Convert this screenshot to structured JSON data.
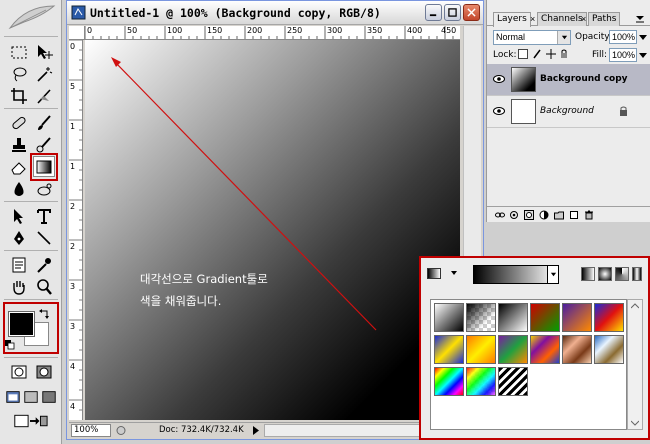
{
  "document": {
    "title": "Untitled-1 @ 100% (Background copy, RGB/8)",
    "ruler_h_ticks": [
      "0",
      "50",
      "100",
      "150",
      "200",
      "250",
      "300",
      "350",
      "400",
      "450"
    ],
    "ruler_v_ticks": [
      "0",
      "5",
      "1",
      "1",
      "2",
      "2",
      "3",
      "3",
      "4",
      "4"
    ],
    "zoom": "100%",
    "doc_info": "Doc: 732.4K/732.4K"
  },
  "caption": {
    "line1": "대각선으로 Gradient툴로",
    "line2": "색을 채워줍니다."
  },
  "layers_panel": {
    "tabs": [
      "Layers",
      "Channels",
      "Paths"
    ],
    "blend_mode": "Normal",
    "opacity_label": "Opacity:",
    "opacity_value": "100%",
    "lock_label": "Lock:",
    "fill_label": "Fill:",
    "fill_value": "100%",
    "layers": [
      {
        "name": "Background copy",
        "selected": true
      },
      {
        "name": "Background",
        "selected": false
      }
    ]
  },
  "toolbox": {
    "foreground_color": "#000000",
    "background_color": "#ffffff"
  },
  "gradient_picker": {
    "presets": [
      [
        "black-white",
        "checker-fade",
        "black-white-2",
        "red-green",
        "violet-orange",
        "blue-red-yellow"
      ],
      [
        "blue-yellow-blue",
        "orange-yellow-orange",
        "violet-green-orange",
        "yellow-violet-orange-blue",
        "copper",
        "chrome"
      ],
      [
        "spectrum",
        "transparent-rainbow",
        "transparent-stripes"
      ]
    ]
  },
  "colors": {
    "highlight": "#c00000",
    "arrow": "#d01010",
    "selected_layer": "#b8b9c6"
  }
}
